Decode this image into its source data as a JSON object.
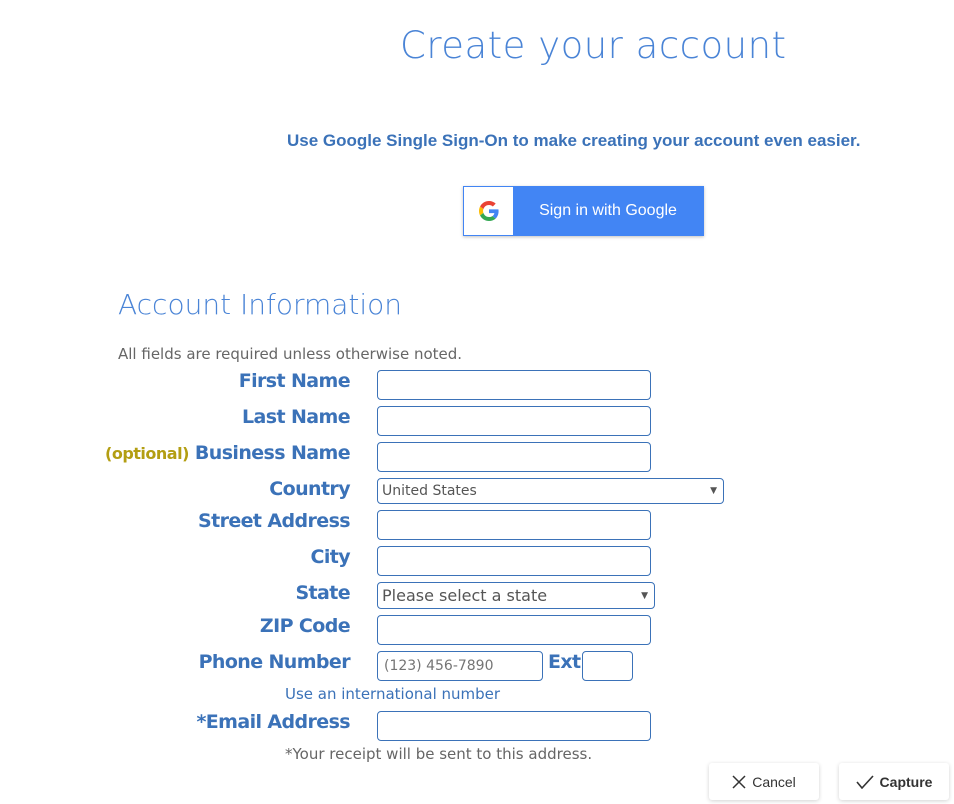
{
  "header": {
    "title": "Create your account",
    "sso_prompt": "Use Google Single Sign-On to make creating your account even easier.",
    "google_button_label": "Sign in with Google",
    "google_icon": "google-g-icon"
  },
  "form": {
    "section_title": "Account Information",
    "section_note": "All fields are required unless otherwise noted.",
    "optional_tag": "(optional)",
    "fields": {
      "first_name": {
        "label": "First Name",
        "value": ""
      },
      "last_name": {
        "label": "Last Name",
        "value": ""
      },
      "business_name": {
        "label": "Business Name",
        "value": ""
      },
      "country": {
        "label": "Country",
        "selected": "United States"
      },
      "street_address": {
        "label": "Street Address",
        "value": ""
      },
      "city": {
        "label": "City",
        "value": ""
      },
      "state": {
        "label": "State",
        "selected": "Please select a state"
      },
      "zip": {
        "label": "ZIP Code",
        "value": ""
      },
      "phone": {
        "label": "Phone Number",
        "placeholder": "(123) 456-7890",
        "value": ""
      },
      "ext": {
        "label": "Ext",
        "value": ""
      },
      "email": {
        "label": "*Email Address",
        "value": ""
      }
    },
    "phone_helper": "Use an international number",
    "email_helper": "*Your receipt will be sent to this address."
  },
  "footer": {
    "cancel_label": "Cancel",
    "cancel_icon": "x-icon",
    "capture_label": "Capture",
    "capture_icon": "checkmark-icon"
  },
  "colors": {
    "brand_blue": "#3b72b8",
    "title_blue": "#4a84d6",
    "google_blue": "#4285f4",
    "optional_gold": "#b39e12"
  }
}
